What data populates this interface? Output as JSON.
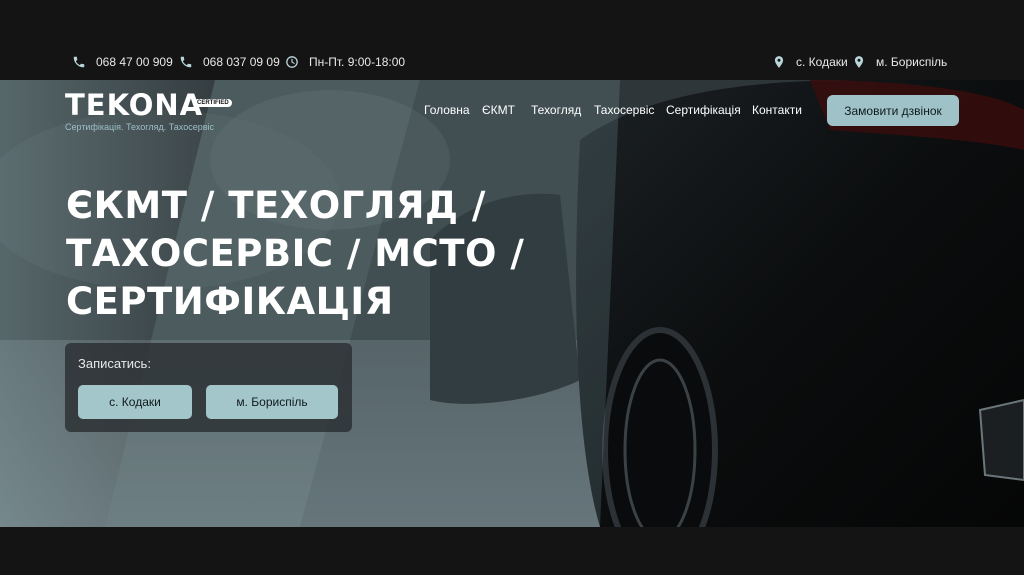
{
  "topbar": {
    "phone1": "068 47 00 909",
    "phone2": "068 037 09 09",
    "hours": "Пн-Пт. 9:00-18:00",
    "location1": "с. Кодаки",
    "location2": "м. Бориспіль"
  },
  "logo": {
    "name": "TEKONA",
    "badge": "CERTIFIED",
    "tagline": "Сертифікація. Техогляд. Тахосервіс"
  },
  "nav": {
    "items": [
      "Головна",
      "ЄКМТ",
      "Техогляд",
      "Тахосервіс",
      "Сертифікація",
      "Контакти"
    ]
  },
  "header": {
    "call_button": "Замовити дзвінок"
  },
  "hero": {
    "headline_line1": "ЄКМТ / ТЕХОГЛЯД /",
    "headline_line2": "ТАХОСЕРВІС / МСТО /",
    "headline_line3": "СЕРТИФІКАЦІЯ"
  },
  "signup": {
    "label": "Записатись:",
    "button1": "с. Кодаки",
    "button2": "м. Бориспіль"
  },
  "colors": {
    "accent": "#9ec2c8",
    "background": "#141414"
  },
  "icons": {
    "phone": "phone-icon",
    "clock": "clock-icon",
    "location": "location-pin-icon"
  }
}
